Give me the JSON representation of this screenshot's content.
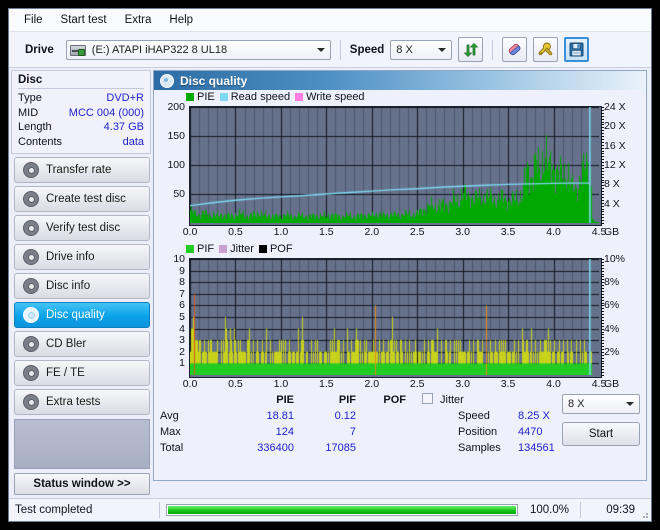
{
  "menu": {
    "items": [
      "File",
      "Start test",
      "Extra",
      "Help"
    ]
  },
  "toolbar": {
    "drive_label": "Drive",
    "drive_value": "(E:)  ATAPI iHAP322  8 UL18",
    "speed_label": "Speed",
    "speed_value": "8 X",
    "icons": {
      "refresh": "refresh-icon",
      "eraser": "eraser-icon",
      "tools": "tools-icon",
      "save": "save-icon"
    }
  },
  "disc": {
    "title": "Disc",
    "rows": [
      {
        "key": "Type",
        "value": "DVD+R"
      },
      {
        "key": "MID",
        "value": "MCC 004 (000)"
      },
      {
        "key": "Length",
        "value": "4.37 GB"
      },
      {
        "key": "Contents",
        "value": "data"
      }
    ]
  },
  "nav": {
    "items": [
      {
        "label": "Transfer rate",
        "active": false
      },
      {
        "label": "Create test disc",
        "active": false
      },
      {
        "label": "Verify test disc",
        "active": false
      },
      {
        "label": "Drive info",
        "active": false
      },
      {
        "label": "Disc info",
        "active": false
      },
      {
        "label": "Disc quality",
        "active": true
      },
      {
        "label": "CD Bler",
        "active": false
      },
      {
        "label": "FE / TE",
        "active": false
      },
      {
        "label": "Extra tests",
        "active": false
      }
    ],
    "status_window": "Status window >>"
  },
  "panel": {
    "title": "Disc quality"
  },
  "stats": {
    "col_pie": "PIE",
    "col_pif": "PIF",
    "col_pof": "POF",
    "jitter_label": "Jitter",
    "jitter_checked": false,
    "row_avg": "Avg",
    "row_max": "Max",
    "row_total": "Total",
    "pie_avg": "18.81",
    "pie_max": "124",
    "pie_total": "336400",
    "pif_avg": "0.12",
    "pif_max": "7",
    "pif_total": "17085",
    "pof_avg": "",
    "pof_max": "",
    "pof_total": "",
    "speed_label": "Speed",
    "speed_value": "8.25 X",
    "position_label": "Position",
    "position_value": "4470",
    "samples_label": "Samples",
    "samples_value": "134561",
    "speed_select": "8 X",
    "start_button": "Start"
  },
  "statusbar": {
    "message": "Test completed",
    "percent": "100.0%",
    "percent_value": 100,
    "time": "09:39"
  },
  "colors": {
    "pie": "#00a800",
    "pif": "#22cc22",
    "read_speed": "#7fd9f5",
    "write_speed": "#ff7de0",
    "jitter": "#c9a0d0",
    "pof": "#000000",
    "plot_bg": "#66728c",
    "accent": "#2222cc"
  },
  "chart_data": [
    {
      "type": "area",
      "name": "pie-chart",
      "title": "PIE / Read speed",
      "legend": [
        {
          "label": "PIE",
          "color": "#00a800"
        },
        {
          "label": "Read speed",
          "color": "#7fd9f5"
        },
        {
          "label": "Write speed",
          "color": "#ff7de0"
        }
      ],
      "legend_position": "top-left",
      "xlabel": "GB",
      "ylabel": "PIE",
      "y2label": "X",
      "xlim": [
        0,
        4.5
      ],
      "ylim": [
        0,
        200
      ],
      "y2lim": [
        0,
        24
      ],
      "xticks": [
        "0.0",
        "0.5",
        "1.0",
        "1.5",
        "2.0",
        "2.5",
        "3.0",
        "3.5",
        "4.0",
        "4.5"
      ],
      "yticks": [
        "50",
        "100",
        "150",
        "200"
      ],
      "y2ticks": [
        "4 X",
        "8 X",
        "12 X",
        "16 X",
        "20 X",
        "24 X"
      ],
      "grid": true,
      "series": [
        {
          "name": "PIE",
          "color": "#00a800",
          "x": [
            0.0,
            0.05,
            0.1,
            0.15,
            0.2,
            0.25,
            0.3,
            0.35,
            0.4,
            0.45,
            0.5,
            0.55,
            0.6,
            0.65,
            0.7,
            0.75,
            0.8,
            0.85,
            0.9,
            0.95,
            1.0,
            1.05,
            1.1,
            1.15,
            1.2,
            1.25,
            1.3,
            1.35,
            1.4,
            1.45,
            1.5,
            1.55,
            1.6,
            1.65,
            1.7,
            1.75,
            1.8,
            1.85,
            1.9,
            1.95,
            2.0,
            2.05,
            2.1,
            2.15,
            2.2,
            2.25,
            2.3,
            2.35,
            2.4,
            2.45,
            2.5,
            2.55,
            2.6,
            2.65,
            2.7,
            2.75,
            2.8,
            2.85,
            2.9,
            2.95,
            3.0,
            3.05,
            3.1,
            3.15,
            3.2,
            3.25,
            3.3,
            3.35,
            3.4,
            3.45,
            3.5,
            3.55,
            3.6,
            3.65,
            3.7,
            3.75,
            3.8,
            3.85,
            3.9,
            3.95,
            4.0,
            4.05,
            4.1,
            4.15,
            4.2,
            4.25,
            4.3,
            4.35,
            4.4,
            4.45
          ],
          "values": [
            22,
            16,
            14,
            18,
            13,
            15,
            12,
            14,
            13,
            12,
            14,
            16,
            13,
            12,
            14,
            18,
            13,
            12,
            13,
            11,
            12,
            14,
            12,
            11,
            13,
            12,
            11,
            12,
            13,
            11,
            12,
            14,
            12,
            11,
            12,
            13,
            11,
            12,
            14,
            13,
            12,
            16,
            14,
            13,
            15,
            14,
            13,
            16,
            15,
            14,
            16,
            22,
            26,
            30,
            28,
            32,
            30,
            34,
            40,
            36,
            58,
            42,
            46,
            44,
            42,
            48,
            44,
            40,
            42,
            44,
            38,
            40,
            44,
            48,
            90,
            78,
            104,
            86,
            124,
            92,
            96,
            88,
            78,
            92,
            60,
            56,
            88,
            96,
            90,
            8
          ]
        },
        {
          "name": "Read speed",
          "color": "#7fd9f5",
          "x": [
            0.0,
            0.25,
            0.5,
            0.75,
            1.0,
            1.25,
            1.5,
            1.75,
            2.0,
            2.25,
            2.5,
            2.75,
            3.0,
            3.25,
            3.5,
            3.75,
            4.0,
            4.25,
            4.4
          ],
          "values": [
            3.6,
            4.2,
            4.7,
            5.1,
            5.4,
            5.7,
            6.0,
            6.3,
            6.6,
            6.9,
            7.1,
            7.4,
            7.6,
            7.8,
            8.0,
            8.1,
            8.2,
            8.25,
            8.25
          ],
          "unit": "X"
        },
        {
          "name": "Write speed",
          "color": "#ff7de0",
          "x": [],
          "values": []
        }
      ]
    },
    {
      "type": "bar",
      "name": "pif-chart",
      "title": "PIF / Jitter / POF",
      "legend": [
        {
          "label": "PIF",
          "color": "#22cc22"
        },
        {
          "label": "Jitter",
          "color": "#c9a0d0"
        },
        {
          "label": "POF",
          "color": "#000000"
        }
      ],
      "legend_position": "top-left",
      "xlabel": "GB",
      "ylabel": "PIF",
      "y2label": "%",
      "xlim": [
        0,
        4.5
      ],
      "ylim": [
        0,
        10
      ],
      "y2lim": [
        0,
        10
      ],
      "xticks": [
        "0.0",
        "0.5",
        "1.0",
        "1.5",
        "2.0",
        "2.5",
        "3.0",
        "3.5",
        "4.0",
        "4.5"
      ],
      "yticks": [
        "1",
        "2",
        "3",
        "4",
        "5",
        "6",
        "7",
        "8",
        "9",
        "10"
      ],
      "y2ticks": [
        "2%",
        "4%",
        "6%",
        "8%",
        "10%"
      ],
      "grid": true,
      "series": [
        {
          "name": "PIF",
          "color": "#22cc22",
          "x": [
            0.0,
            0.02,
            0.04,
            0.06,
            0.08,
            0.1,
            0.12,
            0.14,
            0.16,
            0.18,
            0.2,
            0.22,
            0.24,
            0.26,
            0.28,
            0.3,
            0.32,
            0.34,
            0.36,
            0.38,
            0.4,
            0.42,
            0.44,
            0.46,
            0.48,
            0.5,
            0.52,
            0.54,
            0.56,
            0.58,
            0.6,
            0.62,
            0.64,
            0.66,
            0.68,
            0.7,
            0.72,
            0.74,
            0.76,
            0.78,
            0.8,
            0.85,
            0.9,
            0.95,
            1.0,
            1.05,
            1.1,
            1.15,
            1.2,
            1.25,
            1.3,
            1.35,
            1.4,
            1.45,
            1.5,
            1.55,
            1.6,
            1.65,
            1.7,
            1.75,
            1.8,
            1.85,
            1.9,
            1.95,
            2.0,
            2.05,
            2.1,
            2.15,
            2.2,
            2.25,
            2.3,
            2.35,
            2.4,
            2.45,
            2.5,
            2.55,
            2.6,
            2.65,
            2.7,
            2.75,
            2.8,
            2.85,
            2.9,
            2.95,
            3.0,
            3.05,
            3.1,
            3.15,
            3.2,
            3.25,
            3.3,
            3.35,
            3.4,
            3.45,
            3.5,
            3.55,
            3.6,
            3.65,
            3.7,
            3.75,
            3.8,
            3.85,
            3.9,
            3.95,
            4.0,
            4.05,
            4.1,
            4.15,
            4.2,
            4.25,
            4.3,
            4.35,
            4.4
          ],
          "values": [
            3,
            7,
            2,
            5,
            2,
            3,
            1,
            2,
            3,
            1,
            2,
            4,
            1,
            2,
            1,
            1,
            2,
            1,
            3,
            5,
            2,
            1,
            4,
            2,
            4,
            1,
            2,
            1,
            2,
            1,
            2,
            4,
            3,
            2,
            1,
            1,
            2,
            1,
            1,
            1,
            2,
            1,
            1,
            2,
            2,
            1,
            1,
            2,
            4,
            1,
            1,
            2,
            1,
            1,
            1,
            3,
            3,
            1,
            2,
            1,
            4,
            1,
            2,
            1,
            3,
            1,
            2,
            1,
            4,
            1,
            2,
            1,
            1,
            2,
            1,
            1,
            2,
            3,
            2,
            1,
            2,
            1,
            2,
            2,
            1,
            2,
            1,
            2,
            1,
            2,
            1,
            2,
            3,
            2,
            1,
            2,
            1,
            3,
            2,
            2,
            1,
            2,
            4,
            2,
            1,
            2,
            1,
            2,
            1,
            1,
            2,
            1,
            1
          ]
        },
        {
          "name": "Jitter",
          "color": "#c9a0d0",
          "x": [],
          "values": []
        },
        {
          "name": "POF",
          "color": "#000000",
          "x": [],
          "values": []
        }
      ]
    }
  ]
}
